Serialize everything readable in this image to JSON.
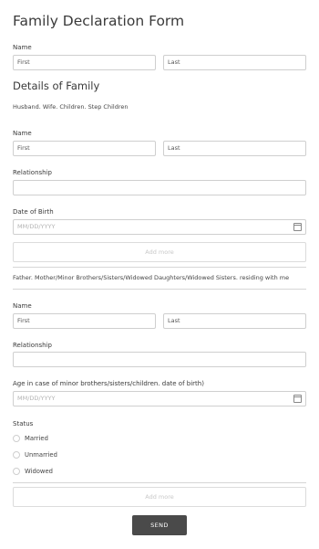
{
  "form": {
    "title": "Family Declaration Form",
    "name_label": "Name",
    "first_name": "First",
    "last_name": "Last"
  },
  "family_section": {
    "title": "Details of Family",
    "description": "Husband. Wife. Children. Step Children",
    "name_label": "Name",
    "first_name": "First",
    "last_name": "Last",
    "relationship_label": "Relationship",
    "relationship_value": "",
    "dob_label": "Date of Birth",
    "dob_placeholder": "MM/DD/YYYY",
    "add_more_label": "Add more"
  },
  "dependents_section": {
    "description": "Father. Mother/Minor Brothers/Sisters/Widowed Daughters/Widowed Sisters. residing with me",
    "name_label": "Name",
    "first_name": "First",
    "last_name": "Last",
    "relationship_label": "Relationship",
    "relationship_value": "",
    "age_label": "Age in case of minor brothers/sisters/children. date of birth)",
    "age_placeholder": "MM/DD/YYYY",
    "status_label": "Status",
    "status_options": [
      "Married",
      "Unmarried",
      "Widowed"
    ],
    "add_more_label": "Add more"
  },
  "actions": {
    "send_label": "SEND"
  },
  "icons": {
    "date_picker": "calendar-icon"
  }
}
